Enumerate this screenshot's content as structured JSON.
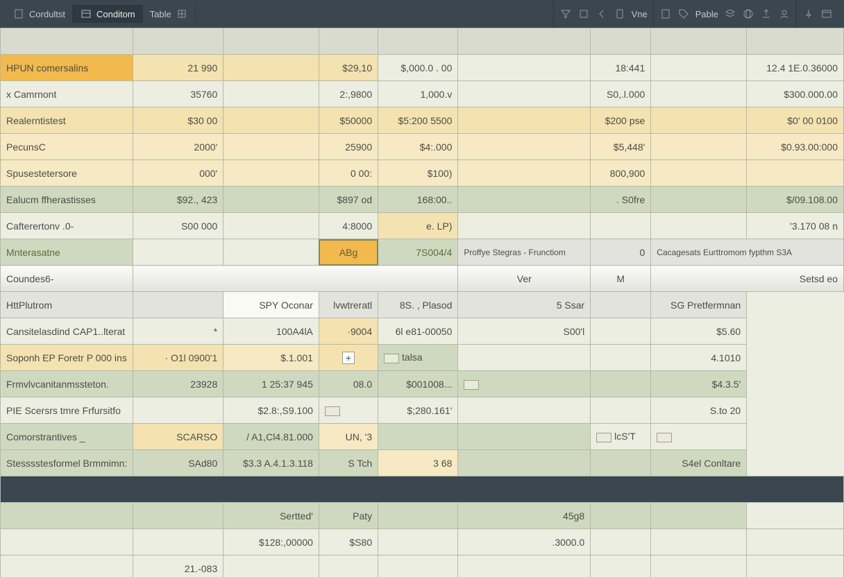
{
  "topbar": {
    "tabs": [
      "Cordultst",
      "Conditom",
      "Table"
    ],
    "tool_labels": [
      "Vne",
      "Pable"
    ]
  },
  "columnHeads": [
    "",
    "",
    "",
    "",
    "",
    "",
    ""
  ],
  "rows_upper": [
    {
      "label": "HPUN comersalins",
      "c": [
        "21 990",
        "",
        "$29,10",
        "$,000.0 . 00",
        "",
        "18:441",
        "",
        "12.4 1E.0.36000"
      ],
      "bg": [
        "bg-orange",
        "bg-beige",
        "bg-beige",
        "bg-beige",
        "bg-none",
        "bg-none",
        "bg-none",
        "bg-none",
        "bg-none"
      ]
    },
    {
      "label": "x Camrnont",
      "c": [
        "35760",
        "",
        "2:,9800",
        "1,000.v",
        "",
        "S0,.l.000",
        "",
        "$300.000.00"
      ],
      "bg": [
        "bg-none",
        "bg-none",
        "bg-none",
        "bg-none",
        "bg-none",
        "bg-none",
        "bg-none",
        "bg-none",
        "bg-none"
      ]
    },
    {
      "label": "Realerntistest",
      "c": [
        "$30 00",
        "",
        "$50000",
        "$5:200 5500",
        "",
        "$200 pse",
        "",
        "$0' 00 0100"
      ],
      "bg": [
        "bg-beige",
        "bg-beige",
        "bg-beige",
        "bg-beige",
        "bg-beige",
        "bg-beige",
        "bg-beige",
        "bg-beige",
        "bg-beige"
      ]
    },
    {
      "label": "PecunsC",
      "c": [
        "2000'",
        "",
        "25900",
        "$4:.000",
        "",
        "$5,448'",
        "",
        "$0.93.00:000"
      ],
      "bg": [
        "bg-cream",
        "bg-cream",
        "bg-cream",
        "bg-cream",
        "bg-cream",
        "bg-cream",
        "bg-cream",
        "bg-cream",
        "bg-cream"
      ]
    },
    {
      "label": "Spusestetersore",
      "c": [
        "000'",
        "",
        "0 00:",
        "$100)",
        "",
        "800,900",
        "",
        ""
      ],
      "bg": [
        "bg-cream",
        "bg-cream",
        "bg-cream",
        "bg-cream",
        "bg-cream",
        "bg-cream",
        "bg-cream",
        "bg-cream",
        "bg-cream"
      ]
    },
    {
      "label": "Ealucm ffherastisses",
      "c": [
        "$92., 423",
        "",
        "$897 od",
        "168:00..",
        "",
        ". S0fre",
        "",
        "$/09.108.00"
      ],
      "bg": [
        "bg-green",
        "bg-green",
        "bg-green",
        "bg-green",
        "bg-green",
        "bg-green",
        "bg-green",
        "bg-green",
        "bg-green"
      ]
    },
    {
      "label": "Cafterertonv  .0-",
      "c": [
        "S00 000",
        "",
        "4:8000",
        "e. LP)",
        "",
        "",
        "",
        "'3.170 08 n"
      ],
      "bg": [
        "bg-none",
        "bg-none",
        "bg-none",
        "bg-none",
        "bg-beige",
        "bg-none",
        "bg-none",
        "bg-none",
        "bg-none"
      ]
    }
  ],
  "mid_strip": {
    "left_label": "Mnterasatne",
    "left2": "",
    "accent1": "ABg",
    "accent2": "7S004/4",
    "right_label1": "Proffye Stegras -  Frunctiom",
    "right_val": "0",
    "right_label2": "Cacagesats Eurttromom fypthm  S3A"
  },
  "sub_strip": {
    "l1": "Coundes6-",
    "l2": "",
    "l3": "Ver",
    "l4": "M",
    "l5": "Setsd eo"
  },
  "rows_lower": [
    {
      "label": "HttPlutrom",
      "c": [
        "",
        "SPY Oconar",
        "lvwtreratl",
        "8S. , Plasod",
        "5 Ssar",
        "",
        "SG Pretfermnan"
      ],
      "bg": [
        "bg-grey",
        "bg-grey",
        "bg-white",
        "bg-grey",
        "bg-grey",
        "bg-grey",
        "bg-grey",
        "bg-grey"
      ]
    },
    {
      "label": "Cansitelasdind CAP1..lterat",
      "c": [
        "*",
        "100A4lA",
        "·9004",
        "6l e81-00050",
        "S00'l",
        "",
        "$5.60"
      ],
      "bg": [
        "bg-none",
        "bg-none",
        "bg-none",
        "bg-beige",
        "bg-none",
        "bg-none",
        "bg-none",
        "bg-none"
      ]
    },
    {
      "label": "Soponh EP   Foretr P 000 ins",
      "c": [
        "· O1l 0900'1",
        "$.1.001",
        "+",
        "☐ talsa",
        "",
        "",
        "4.1010"
      ],
      "bg": [
        "bg-beige",
        "bg-beige",
        "bg-cream",
        "bg-beige",
        "bg-green",
        "bg-none",
        "bg-none",
        "bg-none"
      ],
      "special": "plus"
    },
    {
      "label": "Frmvlvcanitanmssteton.",
      "c": [
        "23928",
        "1  25:37 945",
        "08.0",
        "$001008...",
        "☐",
        "",
        "$4.3.5'"
      ],
      "bg": [
        "bg-green",
        "bg-green",
        "bg-green",
        "bg-green",
        "bg-green",
        "bg-green",
        "bg-green",
        "bg-green"
      ]
    },
    {
      "label": "PIE Scersrs      tmre Frfursitfo",
      "c": [
        "",
        "$2.8:,S9.100",
        "☐",
        "$;280.161'",
        "",
        "",
        "S.to 20"
      ],
      "bg": [
        "bg-none",
        "bg-none",
        "bg-none",
        "bg-none",
        "bg-none",
        "bg-none",
        "bg-none",
        "bg-none"
      ]
    },
    {
      "label": "Comorstrantives _",
      "c": [
        "SCARSO",
        "/ A1,Cl4.81.000",
        "UN,  '3",
        "",
        "",
        "☐ lcS'T",
        "☐"
      ],
      "bg": [
        "bg-green",
        "bg-beige",
        "bg-green",
        "bg-cream",
        "bg-green",
        "bg-green",
        "bg-none",
        "bg-none"
      ]
    },
    {
      "label": "Stesssstesformel Brmmimn:",
      "c": [
        "SAd80",
        "$3.3 A.4.1.3.118",
        "S Tch",
        "3 68",
        "",
        "",
        "S4el Conltare"
      ],
      "bg": [
        "bg-green",
        "bg-green",
        "bg-green",
        "bg-green",
        "bg-cream",
        "bg-green",
        "bg-green",
        "bg-green"
      ]
    }
  ],
  "footer": [
    [
      "",
      "",
      "Sertted'",
      "Paty",
      "",
      "45g8",
      "",
      ""
    ],
    [
      "",
      "",
      "$128:,00000",
      "$S80",
      "",
      ".3000.0",
      "",
      ""
    ],
    [
      "",
      "21.-083",
      "",
      "",
      "",
      "",
      "",
      ""
    ]
  ]
}
